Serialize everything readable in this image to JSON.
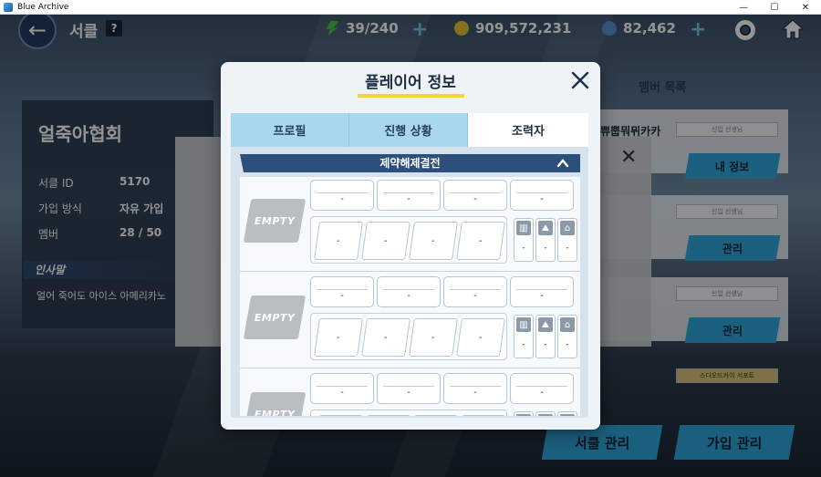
{
  "window": {
    "title": "Blue Archive",
    "controls": [
      "—",
      "☐",
      "✕"
    ]
  },
  "hud": {
    "screen_title": "서클",
    "help": "?",
    "ap": "39/240",
    "credits": "909,572,231",
    "pyroxene": "82,462"
  },
  "club": {
    "name": "얼죽아협회",
    "rows": [
      {
        "label": "서클 ID",
        "value": "5170"
      },
      {
        "label": "가입 방식",
        "value": "자유 가입"
      },
      {
        "label": "멤버",
        "value": "28 / 50"
      }
    ],
    "greeting_label": "인사말",
    "greeting_text": "얼어 죽어도 아이스 아메리카노"
  },
  "members": {
    "header": "멤버 목록",
    "first_name": "쀼뿝뭐뮈카카",
    "tag_text": "신입 선생님",
    "my_info_button": "내 정보",
    "manage_button": "관리",
    "last_tag_text": "스다오드카이 서포트"
  },
  "bottom": {
    "club_manage": "서클 관리",
    "join_manage": "가입 관리"
  },
  "modal": {
    "title": "플레이어 정보",
    "tabs": [
      {
        "label": "프로필",
        "active": false
      },
      {
        "label": "진행 상황",
        "active": false
      },
      {
        "label": "조력자",
        "active": true
      }
    ],
    "section": "제약해제결전",
    "empty_label": "EMPTY",
    "dash": "-",
    "slots": 3
  },
  "colors": {
    "accent_blue": "#2fa6d9",
    "title_underline": "#f5d43c",
    "section_bar": "#2d4f7c"
  }
}
